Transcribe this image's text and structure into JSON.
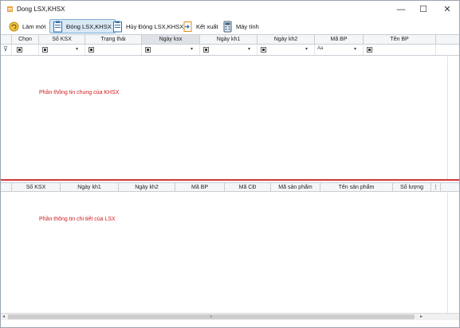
{
  "window": {
    "title": "Dong LSX,KHSX",
    "minimize": "—",
    "maximize": "☐",
    "close": "✕"
  },
  "toolbar": {
    "new_label": "Làm mới",
    "close_label": "Đóng LSX,KHSX",
    "unclose_label": "Hủy Đóng LSX,KHSX",
    "export_label": "Kết xuất",
    "calc_label": "Máy tính"
  },
  "grid1": {
    "columns": [
      "Chọn",
      "Số KSX",
      "Trạng thái",
      "Ngày ksx",
      "Ngày kh1",
      "Ngày kh2",
      "Mã BP",
      "Tên BP"
    ],
    "sorted_column": "Ngày ksx",
    "filter_text_icon": "Aa",
    "hint": "Phần thông tin chung của KHSX"
  },
  "grid2": {
    "columns": [
      "Số KSX",
      "Ngày kh1",
      "Ngày kh2",
      "Mã BP",
      "Mã CĐ",
      "Mã sản phẩm",
      "Tên sản phẩm",
      "Số lượng"
    ],
    "hint": "Phần thông tin chi tiết của LSX"
  },
  "scrollbar": {
    "thumb_grip": "≡"
  },
  "colors": {
    "accent": "#d21c1c",
    "header_bg": "#f4f6f8",
    "active_button": "#d8e8f5"
  }
}
